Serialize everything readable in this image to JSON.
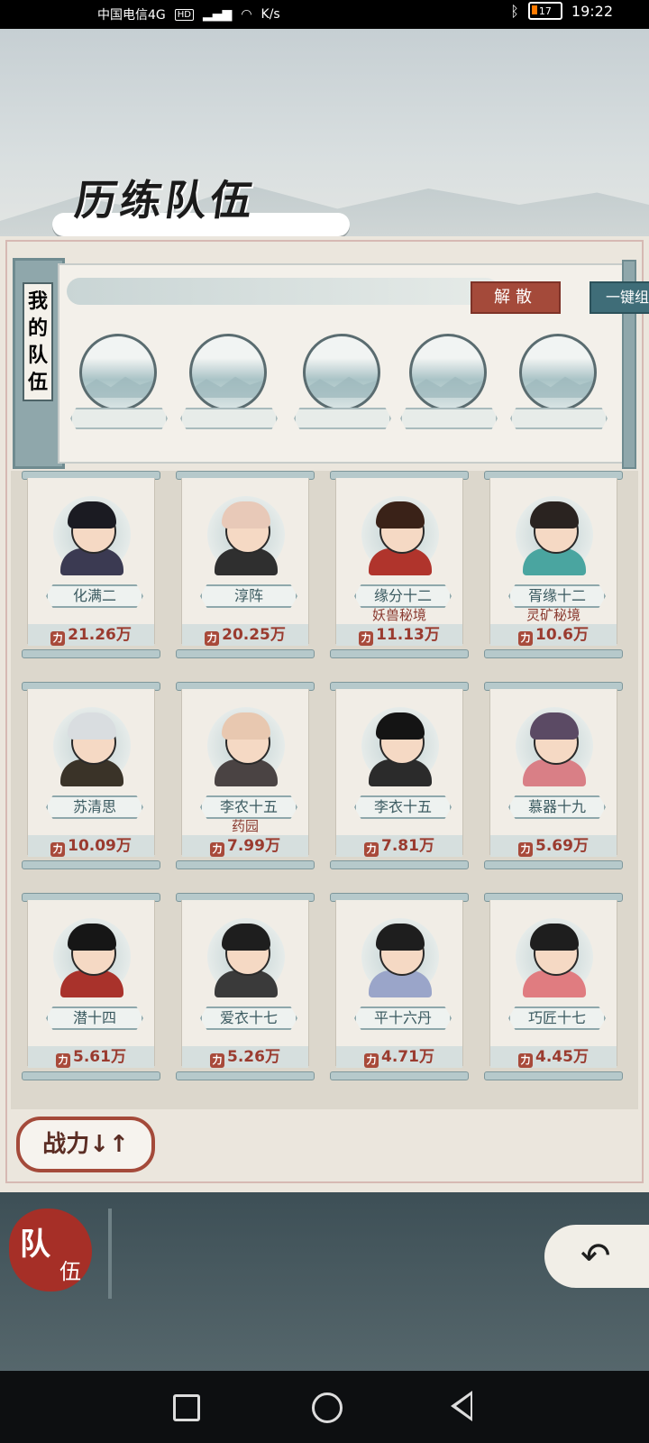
{
  "status_bar": {
    "carrier": "中国电信4G",
    "hd": "HD",
    "speed_unit": "K/s",
    "battery": "17",
    "time": "19:22"
  },
  "header": {
    "title": "历练队伍"
  },
  "my_team": {
    "side_label": [
      "我",
      "的",
      "队",
      "伍"
    ],
    "dismiss_label": "解散",
    "auto_form_label": "一键组队",
    "slots": 5
  },
  "heroes": [
    {
      "name": "化满二",
      "location": "",
      "power": "21.26万",
      "hair": "#1b1b22",
      "robe": "#3b3a52"
    },
    {
      "name": "淳阵",
      "location": "",
      "power": "20.25万",
      "hair": "#e8c9b8",
      "robe": "#2f2f2f"
    },
    {
      "name": "缘分十二",
      "location": "妖兽秘境",
      "power": "11.13万",
      "hair": "#3a2218",
      "robe": "#b0342c"
    },
    {
      "name": "胥缘十二",
      "location": "灵矿秘境",
      "power": "10.6万",
      "hair": "#2a2320",
      "robe": "#4aa5a0"
    },
    {
      "name": "苏清思",
      "location": "",
      "power": "10.09万",
      "hair": "#d9dde0",
      "robe": "#3a3328"
    },
    {
      "name": "李农十五",
      "location": "药园",
      "power": "7.99万",
      "hair": "#e8c8b0",
      "robe": "#4a4343"
    },
    {
      "name": "李衣十五",
      "location": "",
      "power": "7.81万",
      "hair": "#141414",
      "robe": "#2b2b2b"
    },
    {
      "name": "慕器十九",
      "location": "",
      "power": "5.69万",
      "hair": "#5b4a64",
      "robe": "#d97f86"
    },
    {
      "name": "潜十四",
      "location": "",
      "power": "5.61万",
      "hair": "#161616",
      "robe": "#a9322b"
    },
    {
      "name": "爱衣十七",
      "location": "",
      "power": "5.26万",
      "hair": "#1e1e1e",
      "robe": "#3a3a3a"
    },
    {
      "name": "平十六丹",
      "location": "",
      "power": "4.71万",
      "hair": "#1e1e1e",
      "robe": "#9aa5c9"
    },
    {
      "name": "巧匠十七",
      "location": "",
      "power": "4.45万",
      "hair": "#1e1e1e",
      "robe": "#e07c80"
    }
  ],
  "sort_button": {
    "label": "战力↓↑"
  },
  "bottom_tab": {
    "char1": "队",
    "char2": "伍"
  },
  "back_icon": "back-arrow-icon",
  "colors": {
    "accent_red": "#a44a3a",
    "accent_teal": "#3f6d78"
  }
}
